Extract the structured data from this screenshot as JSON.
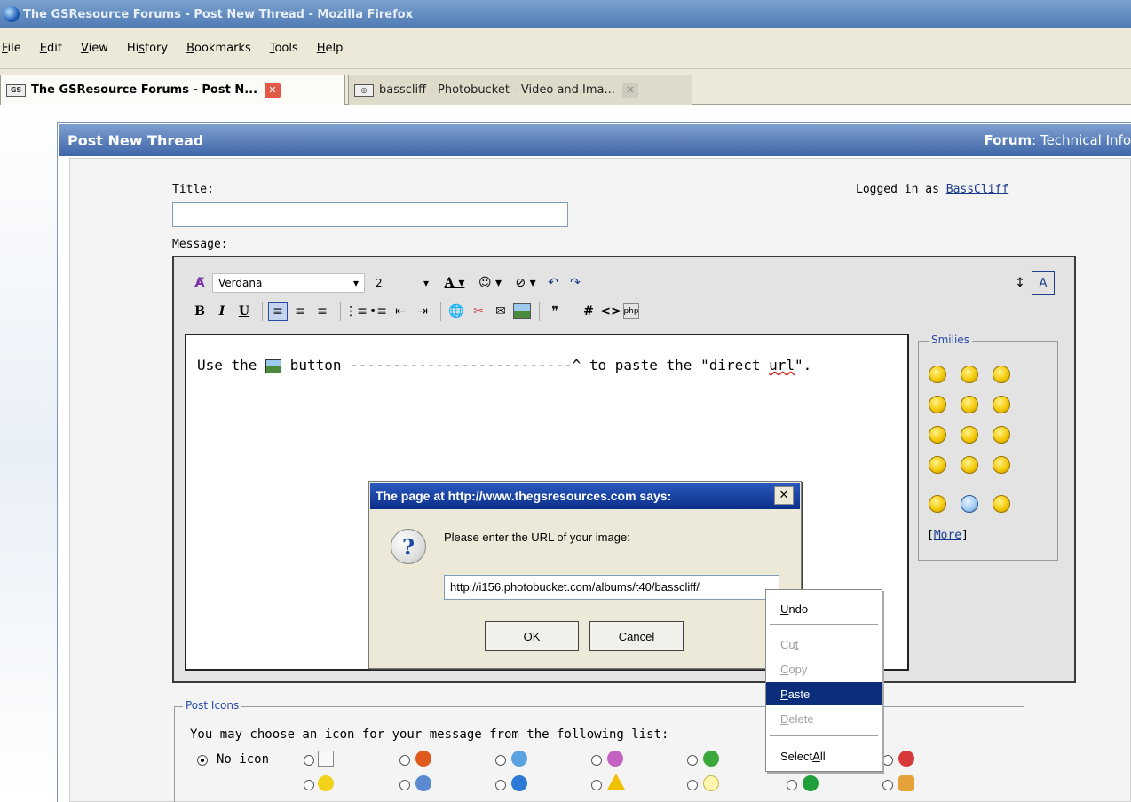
{
  "window": {
    "title": "The GSResource Forums - Post New Thread - Mozilla Firefox"
  },
  "menu": [
    "File",
    "Edit",
    "View",
    "History",
    "Bookmarks",
    "Tools",
    "Help"
  ],
  "tabs": [
    {
      "favicon": "GS",
      "label": "The GSResource Forums - Post N...",
      "active": true
    },
    {
      "label": "basscliff - Photobucket - Video and Ima...",
      "active": false
    }
  ],
  "page": {
    "header": "Post New Thread",
    "forum_label": "Forum",
    "forum_value": ": Technical Info",
    "title_label": "Title:",
    "logged_in_prefix": "Logged in as ",
    "logged_in_user": "BassCliff",
    "message_label": "Message:"
  },
  "editor": {
    "font": "Verdana",
    "size": "2",
    "content_before": "Use the ",
    "content_after": " button --------------------------^ to paste the \"direct ",
    "content_word": "url",
    "content_end": "\"."
  },
  "smilies": {
    "legend": "Smilies",
    "more": "More"
  },
  "post_icons": {
    "legend": "Post Icons",
    "text": "You may choose an icon for your message from the following list:",
    "no_icon": "No icon"
  },
  "dialog": {
    "title": "The page at http://www.thegsresources.com says:",
    "message": "Please enter the URL of your image:",
    "input_value": "http://i156.photobucket.com/albums/t40/basscliff/",
    "ok": "OK",
    "cancel": "Cancel"
  },
  "context_menu": [
    "Undo",
    "Cut",
    "Copy",
    "Paste",
    "Delete",
    "Select All"
  ]
}
